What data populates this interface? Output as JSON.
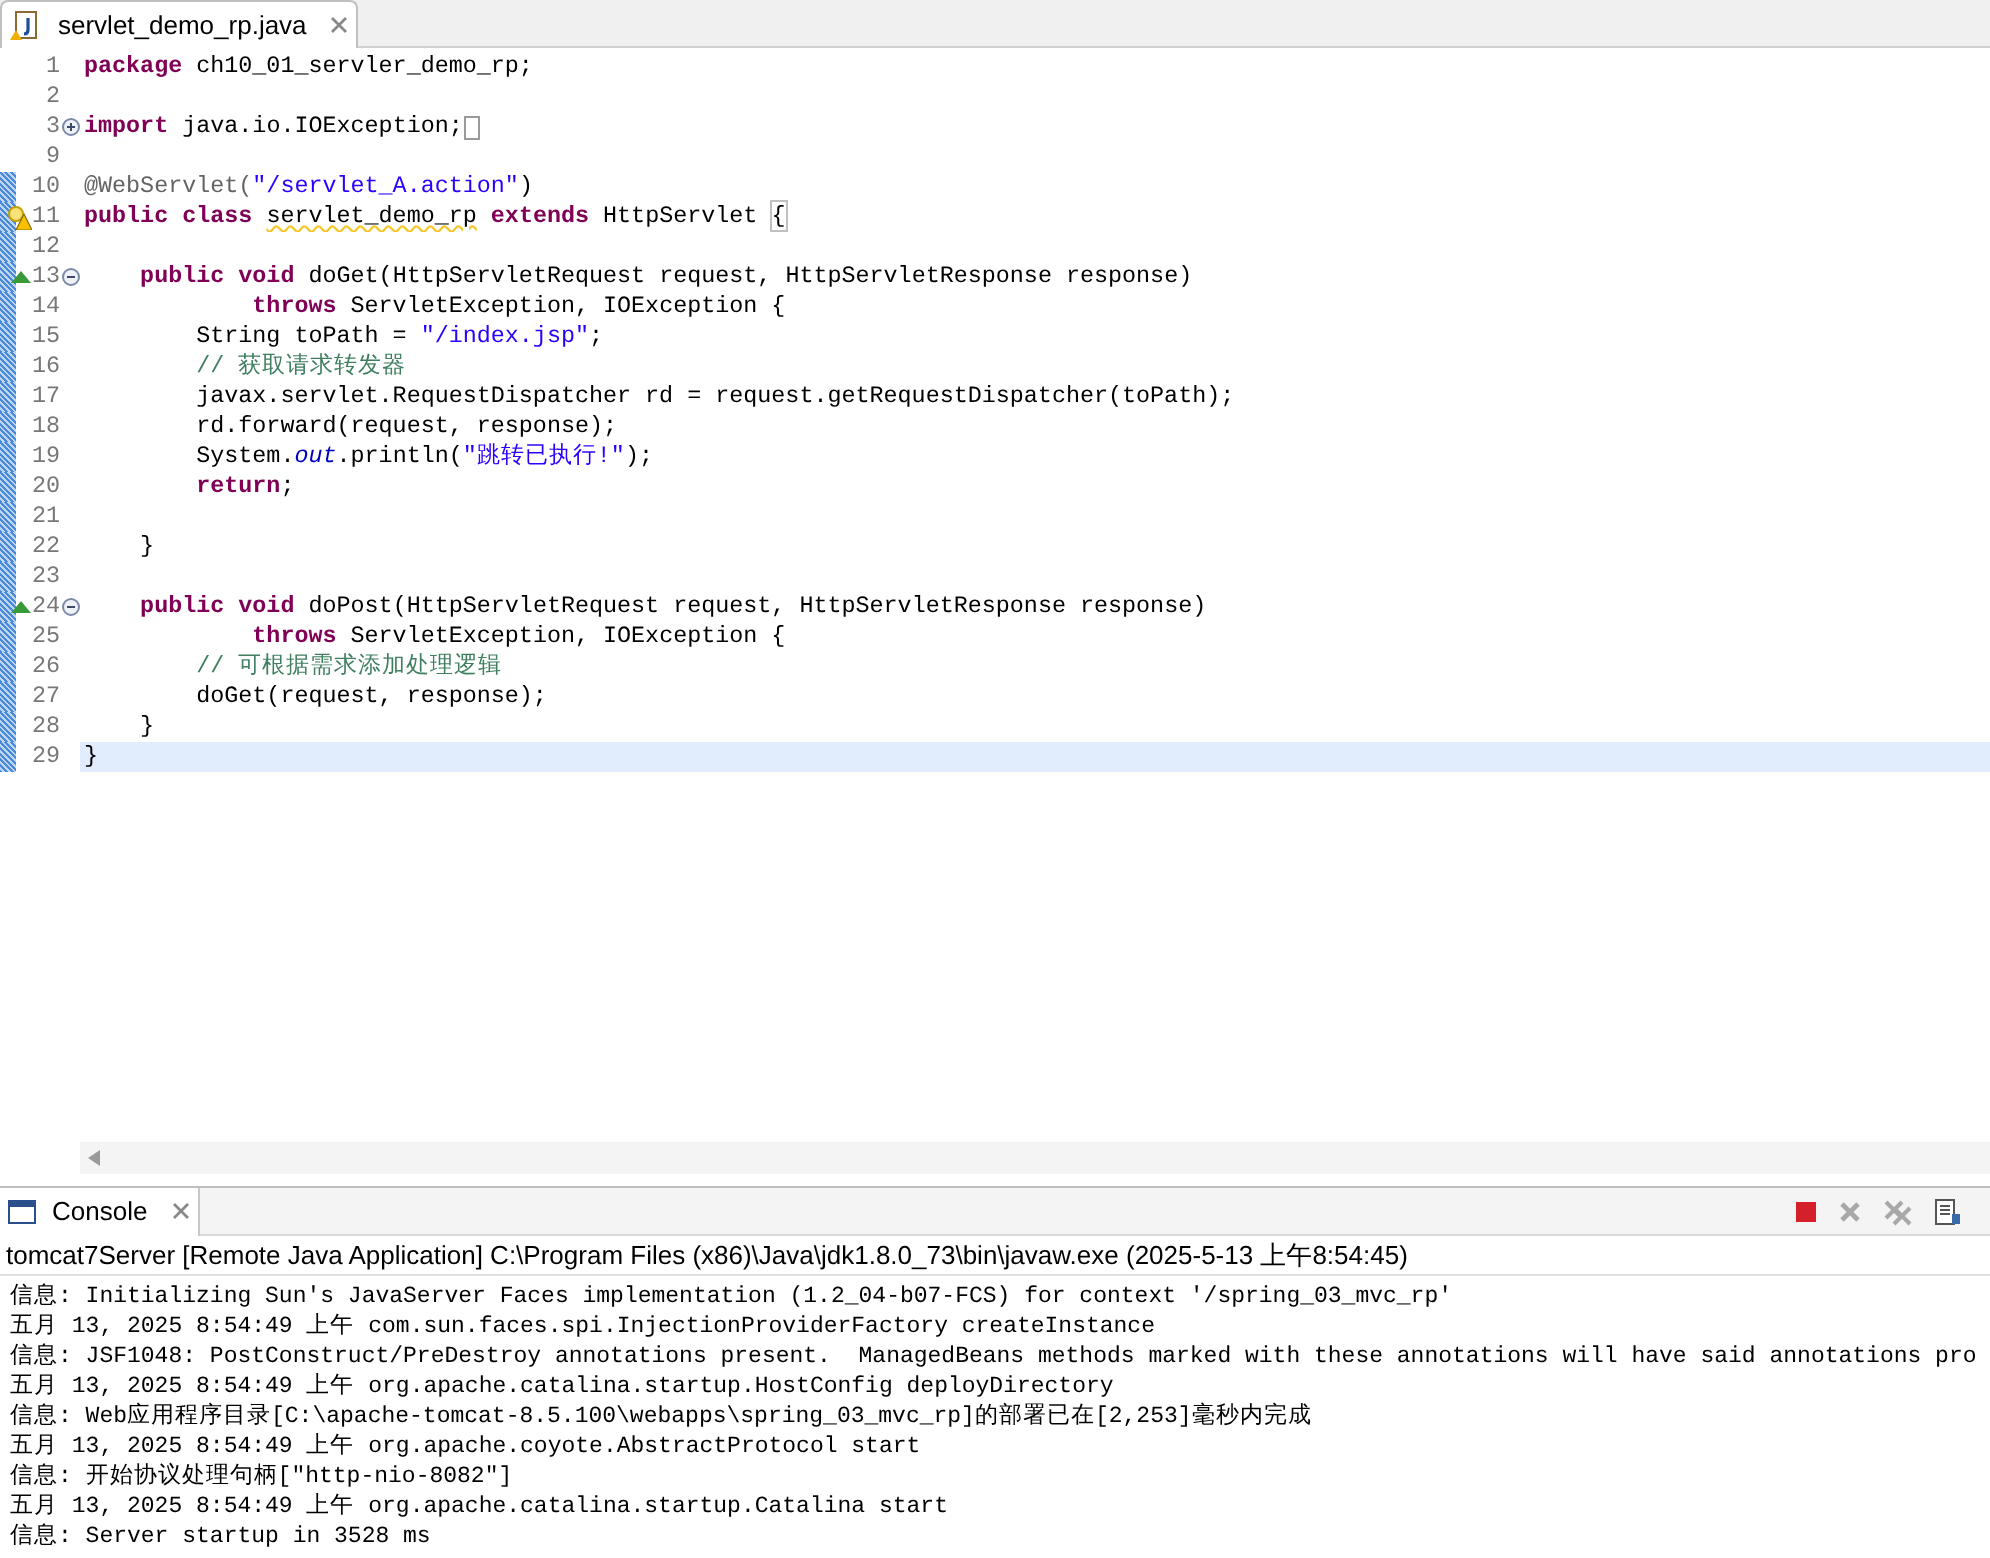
{
  "editor": {
    "tab": {
      "title": "servlet_demo_rp.java",
      "selected": true
    },
    "lines": [
      {
        "number": "1",
        "changed": false,
        "current": false,
        "warning": false,
        "override": false,
        "foldable": false,
        "tokens": [
          {
            "kind": "kw",
            "text": "package "
          },
          {
            "kind": "plain",
            "text": "ch10_01_servler_demo_rp;"
          }
        ]
      },
      {
        "number": "2",
        "changed": false,
        "current": false,
        "warning": false,
        "override": false,
        "foldable": false
      },
      {
        "number": "3",
        "changed": false,
        "current": false,
        "warning": false,
        "override": false,
        "foldable": true,
        "expanded": false,
        "tokens": [
          {
            "kind": "kw",
            "text": "import "
          },
          {
            "kind": "plain",
            "text": "java.io.IOException;"
          }
        ]
      },
      {
        "number": "9",
        "changed": false,
        "current": false,
        "warning": false,
        "override": false,
        "foldable": false
      },
      {
        "number": "10",
        "changed": true,
        "current": false,
        "warning": false,
        "override": false,
        "foldable": false,
        "tokens": [
          {
            "kind": "annotation",
            "text": "@WebServlet("
          },
          {
            "kind": "str",
            "text": "\"/servlet_A.action\""
          },
          {
            "kind": "plain",
            "text": ")"
          }
        ]
      },
      {
        "number": "11",
        "changed": true,
        "current": false,
        "warning": true,
        "override": false,
        "foldable": false,
        "tokens": [
          {
            "kind": "kw",
            "text": "public class "
          },
          {
            "kind": "warn",
            "text": "servlet_demo_rp"
          },
          {
            "kind": "kw",
            "text": " extends"
          },
          {
            "kind": "plain",
            "text": " HttpServlet "
          },
          {
            "kind": "bracket",
            "text": "{"
          }
        ]
      },
      {
        "number": "12",
        "changed": true,
        "current": false,
        "warning": false,
        "override": false,
        "foldable": false
      },
      {
        "number": "13",
        "changed": true,
        "current": false,
        "warning": false,
        "override": true,
        "foldable": true,
        "expanded": true,
        "tokens": [
          {
            "kind": "kw",
            "text": "    public void"
          },
          {
            "kind": "plain",
            "text": " doGet(HttpServletRequest request, HttpServletResponse response)"
          }
        ]
      },
      {
        "number": "14",
        "changed": true,
        "current": false,
        "warning": false,
        "override": false,
        "foldable": false,
        "tokens": [
          {
            "kind": "kw",
            "text": "            throws"
          },
          {
            "kind": "plain",
            "text": " ServletException, IOException {"
          }
        ]
      },
      {
        "number": "15",
        "changed": true,
        "current": false,
        "warning": false,
        "override": false,
        "foldable": false,
        "tokens": [
          {
            "kind": "plain",
            "text": "        String toPath = "
          },
          {
            "kind": "str",
            "text": "\"/index.jsp\""
          },
          {
            "kind": "plain",
            "text": ";"
          }
        ]
      },
      {
        "number": "16",
        "changed": true,
        "current": false,
        "warning": false,
        "override": false,
        "foldable": false,
        "tokens": [
          {
            "kind": "comment",
            "text": "        // 获取请求转发器"
          }
        ]
      },
      {
        "number": "17",
        "changed": true,
        "current": false,
        "warning": false,
        "override": false,
        "foldable": false,
        "tokens": [
          {
            "kind": "plain",
            "text": "        javax.servlet.RequestDispatcher rd = request.getRequestDispatcher(toPath);"
          }
        ]
      },
      {
        "number": "18",
        "changed": true,
        "current": false,
        "warning": false,
        "override": false,
        "foldable": false,
        "tokens": [
          {
            "kind": "plain",
            "text": "        rd.forward(request, response);"
          }
        ]
      },
      {
        "number": "19",
        "changed": true,
        "current": false,
        "warning": false,
        "override": false,
        "foldable": false,
        "tokens": [
          {
            "kind": "plain",
            "text": "        System."
          },
          {
            "kind": "field",
            "text": "out"
          },
          {
            "kind": "plain",
            "text": ".println("
          },
          {
            "kind": "str",
            "text": "\"跳转已执行!\""
          },
          {
            "kind": "plain",
            "text": ");"
          }
        ]
      },
      {
        "number": "20",
        "changed": true,
        "current": false,
        "warning": false,
        "override": false,
        "foldable": false,
        "tokens": [
          {
            "kind": "kw",
            "text": "        return"
          },
          {
            "kind": "plain",
            "text": ";"
          }
        ]
      },
      {
        "number": "21",
        "changed": true,
        "current": false,
        "warning": false,
        "override": false,
        "foldable": false
      },
      {
        "number": "22",
        "changed": true,
        "current": false,
        "warning": false,
        "override": false,
        "foldable": false,
        "tokens": [
          {
            "kind": "plain",
            "text": "    }"
          }
        ]
      },
      {
        "number": "23",
        "changed": true,
        "current": false,
        "warning": false,
        "override": false,
        "foldable": false
      },
      {
        "number": "24",
        "changed": true,
        "current": false,
        "warning": false,
        "override": true,
        "foldable": true,
        "expanded": true,
        "tokens": [
          {
            "kind": "kw",
            "text": "    public void"
          },
          {
            "kind": "plain",
            "text": " doPost(HttpServletRequest request, HttpServletResponse response)"
          }
        ]
      },
      {
        "number": "25",
        "changed": true,
        "current": false,
        "warning": false,
        "override": false,
        "foldable": false,
        "tokens": [
          {
            "kind": "kw",
            "text": "            throws"
          },
          {
            "kind": "plain",
            "text": " ServletException, IOException {"
          }
        ]
      },
      {
        "number": "26",
        "changed": true,
        "current": false,
        "warning": false,
        "override": false,
        "foldable": false,
        "tokens": [
          {
            "kind": "comment",
            "text": "        // 可根据需求添加处理逻辑"
          }
        ]
      },
      {
        "number": "27",
        "changed": true,
        "current": false,
        "warning": false,
        "override": false,
        "foldable": false,
        "tokens": [
          {
            "kind": "plain",
            "text": "        doGet(request, response);"
          }
        ]
      },
      {
        "number": "28",
        "changed": true,
        "current": false,
        "warning": false,
        "override": false,
        "foldable": false,
        "tokens": [
          {
            "kind": "plain",
            "text": "    }"
          }
        ]
      },
      {
        "number": "29",
        "changed": true,
        "current": true,
        "warning": false,
        "override": false,
        "foldable": false,
        "tokens": [
          {
            "kind": "plain",
            "text": "}"
          }
        ]
      }
    ]
  },
  "console": {
    "title": "Console",
    "process": "tomcat7Server [Remote Java Application] C:\\Program Files (x86)\\Java\\jdk1.8.0_73\\bin\\javaw.exe (2025-5-13 上午8:54:45)",
    "lines": [
      "信息: Initializing Sun's JavaServer Faces implementation (1.2_04-b07-FCS) for context '/spring_03_mvc_rp'",
      "五月 13, 2025 8:54:49 上午 com.sun.faces.spi.InjectionProviderFactory createInstance",
      "信息: JSF1048: PostConstruct/PreDestroy annotations present.  ManagedBeans methods marked with these annotations will have said annotations pro",
      "五月 13, 2025 8:54:49 上午 org.apache.catalina.startup.HostConfig deployDirectory",
      "信息: Web应用程序目录[C:\\apache-tomcat-8.5.100\\webapps\\spring_03_mvc_rp]的部署已在[2,253]毫秒内完成",
      "五月 13, 2025 8:54:49 上午 org.apache.coyote.AbstractProtocol start",
      "信息: 开始协议处理句柄[\"http-nio-8082\"]",
      "五月 13, 2025 8:54:49 上午 org.apache.catalina.startup.Catalina start",
      "信息: Server startup in 3528 ms"
    ]
  }
}
